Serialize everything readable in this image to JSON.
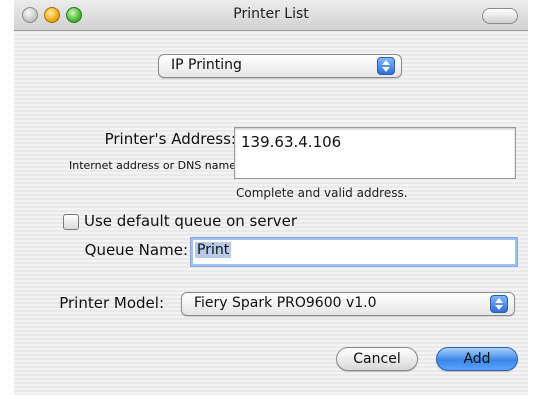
{
  "window": {
    "title": "Printer List"
  },
  "protocol_select": {
    "value": "IP Printing"
  },
  "address": {
    "label": "Printer's Address:",
    "sublabel": "Internet address or DNS name",
    "value": "139.63.4.106",
    "status": "Complete and valid address."
  },
  "default_queue": {
    "label": "Use default queue on server",
    "checked": false
  },
  "queue": {
    "label": "Queue Name:",
    "value": "Print"
  },
  "model": {
    "label": "Printer Model:",
    "value": "Fiery Spark PRO9600 v1.0"
  },
  "buttons": {
    "cancel": "Cancel",
    "add": "Add"
  }
}
